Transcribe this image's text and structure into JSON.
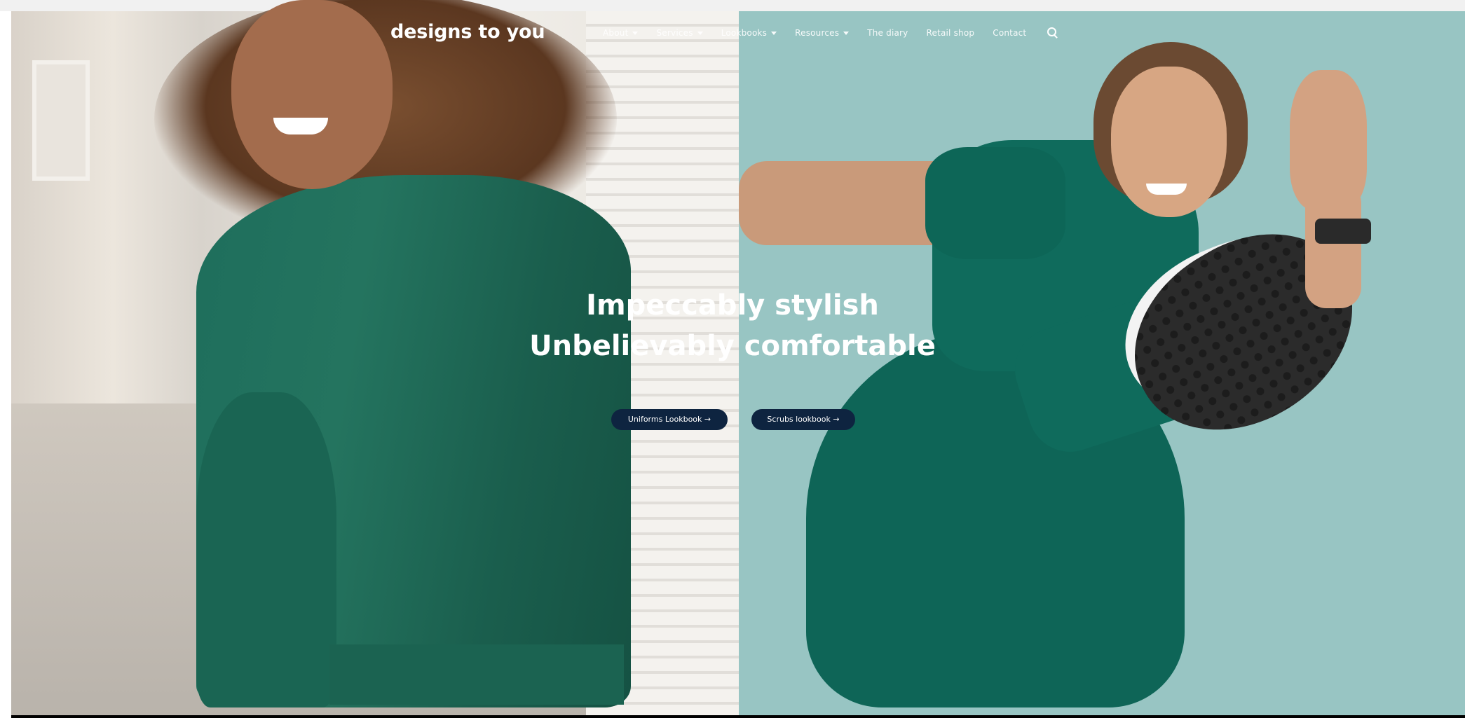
{
  "header": {
    "logo": "designs to you",
    "menu": [
      {
        "label": "About",
        "dropdown": true
      },
      {
        "label": "Services",
        "dropdown": true
      },
      {
        "label": "Lookbooks",
        "dropdown": true
      },
      {
        "label": "Resources",
        "dropdown": true
      },
      {
        "label": "The diary",
        "dropdown": false
      },
      {
        "label": "Retail shop",
        "dropdown": false
      },
      {
        "label": "Contact",
        "dropdown": false
      }
    ],
    "search_icon": "search-icon"
  },
  "hero": {
    "headline_line1": "Impeccably stylish",
    "headline_line2": "Unbelievably comfortable",
    "cta_uniforms": "Uniforms Lookbook →",
    "cta_scrubs": "Scrubs lookbook →"
  },
  "colors": {
    "teal_panel": "#98c5c3",
    "button_navy": "#0e2440",
    "scrubs_green": "#0f6b5c"
  }
}
